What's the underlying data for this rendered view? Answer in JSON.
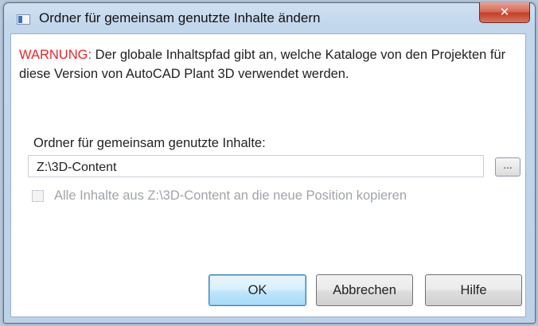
{
  "window": {
    "title": "Ordner für gemeinsam genutzte Inhalte ändern",
    "close_symbol": "✕"
  },
  "warning": {
    "label": "WARNUNG:",
    "text": " Der globale Inhaltspfad gibt an, welche Kataloge von den Projekten für diese Version von AutoCAD Plant 3D verwendet werden."
  },
  "folder": {
    "label": "Ordner für gemeinsam genutzte Inhalte:",
    "value": "Z:\\3D-Content",
    "browse_label": "..."
  },
  "copy_option": {
    "label": "Alle Inhalte aus Z:\\3D-Content an die neue Position kopieren",
    "checked": false,
    "enabled": false
  },
  "buttons": {
    "ok": "OK",
    "cancel": "Abbrechen",
    "help": "Hilfe"
  }
}
